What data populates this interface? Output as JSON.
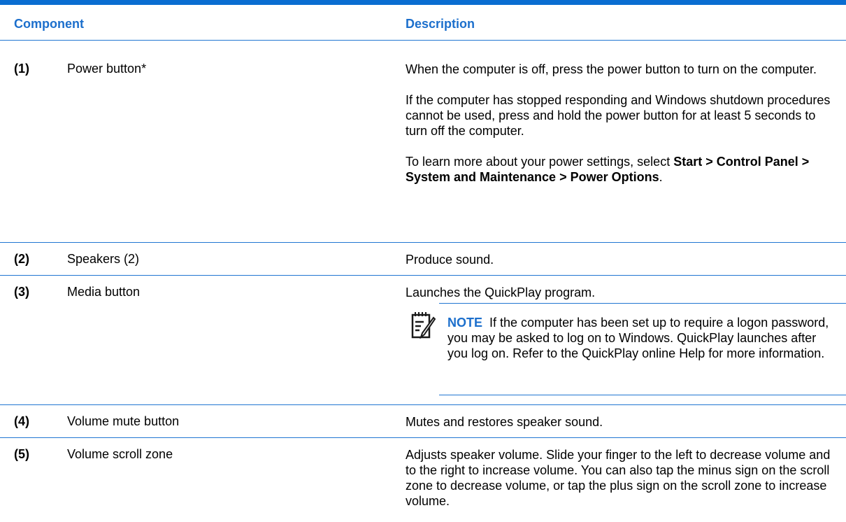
{
  "header": {
    "component": "Component",
    "description": "Description"
  },
  "rows": [
    {
      "num": "(1)",
      "name": "Power button*",
      "p1": "When the computer is off, press the power button to turn on the computer.",
      "p2": "If the computer has stopped responding and Windows shutdown procedures cannot be used, press and hold the power button for at least 5 seconds to turn off the computer.",
      "p3_prefix": "To learn more about your power settings, select ",
      "p3_bold": "Start > Control Panel > System and Maintenance > Power Options",
      "p3_suffix": "."
    },
    {
      "num": "(2)",
      "name": "Speakers (2)",
      "desc": "Produce sound."
    },
    {
      "num": "(3)",
      "name": "Media button",
      "desc": "Launches the QuickPlay program.",
      "note_label": "NOTE",
      "note_text": "If the computer has been set up to require a logon password, you may be asked to log on to Windows. QuickPlay launches after you log on. Refer to the QuickPlay online Help for more information."
    },
    {
      "num": "(4)",
      "name": "Volume mute button",
      "desc": "Mutes and restores speaker sound."
    },
    {
      "num": "(5)",
      "name": "Volume scroll zone",
      "desc": "Adjusts speaker volume. Slide your finger to the left to decrease volume and to the right to increase volume. You can also tap the minus sign on the scroll zone to decrease volume, or tap the plus sign on the scroll zone to increase volume."
    }
  ],
  "icons": {
    "note": "note-pencil-icon"
  },
  "colors": {
    "accent": "#1c6fcc",
    "rule": "#2176d2"
  }
}
